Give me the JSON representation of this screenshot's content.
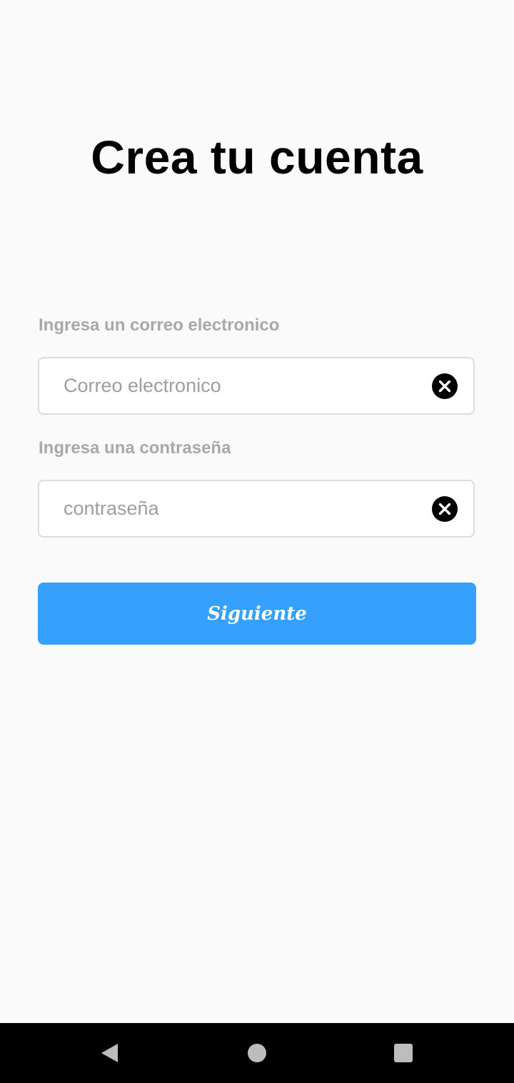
{
  "header": {
    "title": "Crea tu cuenta"
  },
  "form": {
    "email": {
      "label": "Ingresa un correo electronico",
      "placeholder": "Correo electronico",
      "value": "",
      "clear_icon": "close-circle-icon"
    },
    "password": {
      "label": "Ingresa una contraseña",
      "placeholder": "contraseña",
      "value": "",
      "clear_icon": "close-circle-icon"
    },
    "submit_label": "Siguiente"
  },
  "navigation_bar": {
    "back_icon": "triangle-back-icon",
    "home_icon": "circle-home-icon",
    "recent_icon": "square-recents-icon"
  },
  "colors": {
    "background": "#fafafa",
    "accent": "#36a0fe",
    "label": "#a8a8a8",
    "navbar": "#000000"
  }
}
